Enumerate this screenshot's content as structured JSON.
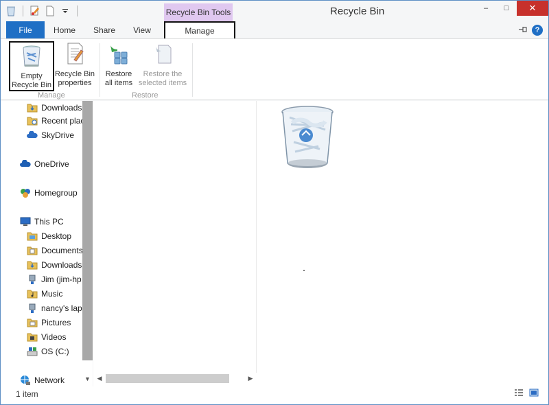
{
  "window": {
    "title": "Recycle Bin",
    "context_tab_header": "Recycle Bin Tools",
    "close_glyph": "✕",
    "minimize_glyph": "–",
    "maximize_glyph": "□"
  },
  "tabs": {
    "file": "File",
    "home": "Home",
    "share": "Share",
    "view": "View",
    "manage": "Manage"
  },
  "ribbon": {
    "manage_group": {
      "label": "Manage",
      "empty_line1": "Empty",
      "empty_line2": "Recycle Bin",
      "props_line1": "Recycle Bin",
      "props_line2": "properties"
    },
    "restore_group": {
      "label": "Restore",
      "all_line1": "Restore",
      "all_line2": "all items",
      "sel_line1": "Restore the",
      "sel_line2": "selected items"
    }
  },
  "nav": {
    "items": [
      {
        "label": "Downloads",
        "icon": "downloads-folder-icon"
      },
      {
        "label": "Recent plac",
        "icon": "recent-places-icon"
      },
      {
        "label": "SkyDrive",
        "icon": "skydrive-icon"
      },
      {
        "label": "OneDrive",
        "icon": "onedrive-icon"
      },
      {
        "label": "Homegroup",
        "icon": "homegroup-icon"
      },
      {
        "label": "This PC",
        "icon": "this-pc-icon"
      },
      {
        "label": "Desktop",
        "icon": "desktop-folder-icon"
      },
      {
        "label": "Documents",
        "icon": "documents-folder-icon"
      },
      {
        "label": "Downloads",
        "icon": "downloads-folder-icon"
      },
      {
        "label": "Jim (jim-hp",
        "icon": "network-user-icon"
      },
      {
        "label": "Music",
        "icon": "music-folder-icon"
      },
      {
        "label": "nancy's lap",
        "icon": "network-user-icon"
      },
      {
        "label": "Pictures",
        "icon": "pictures-folder-icon"
      },
      {
        "label": "Videos",
        "icon": "videos-folder-icon"
      },
      {
        "label": "OS (C:)",
        "icon": "drive-icon"
      },
      {
        "label": "Network",
        "icon": "network-icon"
      }
    ]
  },
  "status": {
    "item_count": "1 item"
  },
  "colors": {
    "file_tab": "#1f6fc5",
    "context_tab": "#e0c8f0",
    "close_button": "#c7312c"
  }
}
